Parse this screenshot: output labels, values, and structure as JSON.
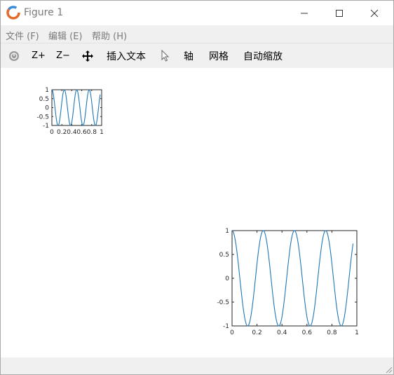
{
  "window": {
    "title": "Figure 1",
    "controls": {
      "minimize": "—",
      "maximize": "☐",
      "close": "✕"
    }
  },
  "menu": {
    "items": [
      {
        "id": "file",
        "label": "文件 (F)"
      },
      {
        "id": "edit",
        "label": "编辑 (E)"
      },
      {
        "id": "help",
        "label": "帮助 (H)"
      }
    ]
  },
  "toolbar": {
    "zoom_in": "Z+",
    "zoom_out": "Z−",
    "insert_text": "插入文本",
    "axis": "轴",
    "grid": "网格",
    "autoscale": "自动缩放"
  },
  "colors": {
    "line": "#1f77b4",
    "menu_text": "#7a7a7a",
    "chrome_bg": "#f0f0f0"
  },
  "chart_data": [
    {
      "type": "line",
      "title": "",
      "xlabel": "",
      "ylabel": "",
      "xlim": [
        0,
        1
      ],
      "ylim": [
        -1,
        1
      ],
      "xticks": [
        "0",
        "0.2",
        "0.4",
        "0.6",
        "0.8",
        "1"
      ],
      "yticks": [
        "-1",
        "-0.5",
        "0",
        "0.5",
        "1"
      ],
      "series": [
        {
          "function": "cos(2*pi*4*x)",
          "frequency_cycles": 4,
          "amplitude": 1,
          "x_range": [
            0,
            0.97
          ]
        }
      ]
    },
    {
      "type": "line",
      "title": "",
      "xlabel": "",
      "ylabel": "",
      "xlim": [
        0,
        1
      ],
      "ylim": [
        -1,
        1
      ],
      "xticks": [
        "0",
        "0.2",
        "0.4",
        "0.6",
        "0.8",
        "1"
      ],
      "yticks": [
        "-1",
        "-0.5",
        "0",
        "0.5",
        "1"
      ],
      "series": [
        {
          "function": "cos(2*pi*4*x)",
          "frequency_cycles": 4,
          "amplitude": 1,
          "x_range": [
            0,
            0.97
          ]
        }
      ]
    }
  ]
}
